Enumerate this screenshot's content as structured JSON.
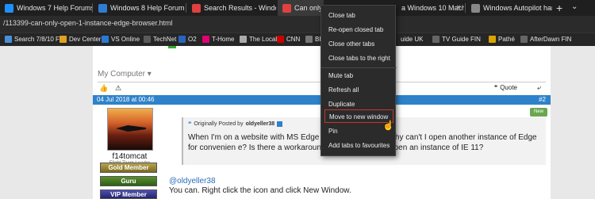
{
  "tabs": [
    {
      "label": "Windows 7 Help Forums",
      "color": "#1e90ff"
    },
    {
      "label": "Windows 8 Help Forums",
      "color": "#2e7dd1"
    },
    {
      "label": "Search Results - Windows 1",
      "color": "#e04040"
    },
    {
      "label": "Can only op",
      "color": "#e04040"
    },
    {
      "label": "a Windows 10 Machi",
      "color": "#2e7dd1"
    },
    {
      "label": "Windows Autopilot hardwa",
      "color": "#888888"
    }
  ],
  "tab_controls": {
    "close": "×",
    "new_tab": "+",
    "chevron": "⌄"
  },
  "address": {
    "url": "/113399-can-only-open-1-instance-edge-browser.html"
  },
  "favorites": [
    {
      "label": "Search 7/8/10 F",
      "color": "#4a90d9"
    },
    {
      "label": "Dev Center",
      "color": "#e0a020"
    },
    {
      "label": "VS Online",
      "color": "#2a7ad5"
    },
    {
      "label": "TechNet",
      "color": "#5a5a5a"
    },
    {
      "label": "O2",
      "color": "#2a64c0"
    },
    {
      "label": "T-Home",
      "color": "#e20074"
    },
    {
      "label": "The Local",
      "color": "#aaaaaa"
    },
    {
      "label": "CNN",
      "color": "#cc0000"
    },
    {
      "label": "BB",
      "color": "#777777"
    },
    {
      "label": "uide UK",
      "color": "#666666"
    },
    {
      "label": "TV Guide FIN",
      "color": "#666666"
    },
    {
      "label": "Pathé",
      "color": "#d9a400"
    },
    {
      "label": "AfterDawn FIN",
      "color": "#666666"
    }
  ],
  "page": {
    "my_computer": "My Computer",
    "quote_label": "Quote",
    "post_date": "04 Jul 2018 at 00:46",
    "post_number": "#2",
    "new_tag": "New",
    "username": "f14tomcat",
    "user_title": "Flight Team Leader",
    "badges": [
      "Gold Member",
      "Guru",
      "VIP Member"
    ],
    "quote_prefix": "Originally Posted by",
    "quote_author": "oldyeller38",
    "quote_text": "When I'm on a website with MS Edge br                            ancial business, why can't I open another instance of Edge for convenien                            e? Is there a workaround without having to open an instance of IE 11?",
    "mention": "@oldyeller38",
    "reply": "You can. Right click the icon and click New Window."
  },
  "context_menu": {
    "items": [
      "Close tab",
      "Re-open closed tab",
      "Close other tabs",
      "Close tabs to the right",
      "Mute tab",
      "Refresh all",
      "Duplicate",
      "Move to new window",
      "Pin",
      "Add tabs to favourites"
    ],
    "highlighted": "Move to new window",
    "highlight_color": "#c0392b"
  }
}
